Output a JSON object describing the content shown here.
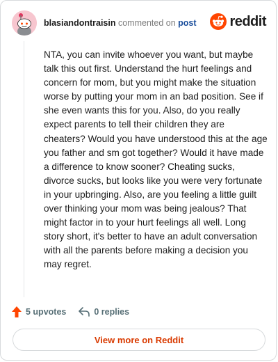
{
  "header": {
    "username": "blasiandontraisin",
    "commented_text": "commented on",
    "post_link": "post",
    "brand": "reddit"
  },
  "comment": {
    "body": "NTA, you can invite whoever you want, but maybe talk this out first. Understand the hurt feelings and concern for mom, but you might make the situation worse by putting your mom in an bad position. See if she even wants this for you. Also, do you really expect parents to tell their children they are cheaters? Would you have understood this at the age you father and sm got together? Would it have made a difference to know sooner? Cheating sucks, divorce sucks, but looks like you were very fortunate in your upbringing. Also, are you feeling a little guilt over thinking your mom was being jealous? That might factor in to your hurt feelings all well. Long story short, it's better to have an adult conversation with all the parents before making a decision you may regret."
  },
  "actions": {
    "upvotes": "5 upvotes",
    "replies": "0 replies"
  },
  "footer": {
    "view_more": "View more on Reddit"
  },
  "colors": {
    "brand_orange": "#ff4500",
    "link_blue": "#1a4e9c",
    "button_text": "#d93a00",
    "muted": "#576f76",
    "avatar_bg": "#f7c6cf"
  },
  "icons": {
    "avatar": "snoo-avatar-icon",
    "brand": "reddit-logo-icon",
    "upvote": "upvote-arrow-icon",
    "reply": "reply-arrow-icon"
  }
}
